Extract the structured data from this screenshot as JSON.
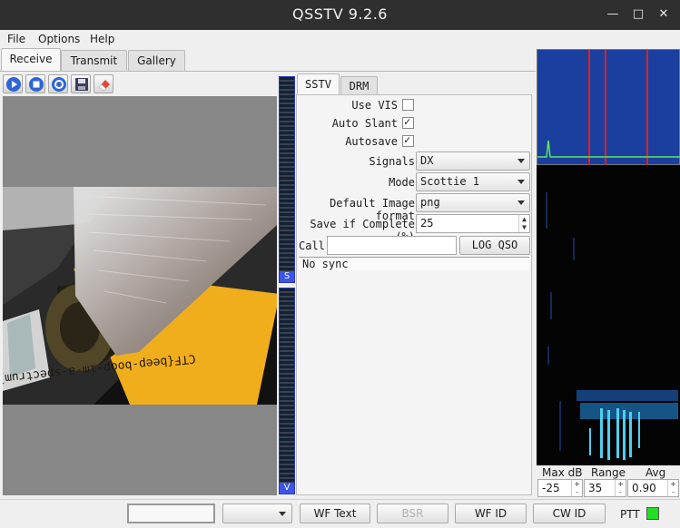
{
  "window": {
    "title": "QSSTV 9.2.6"
  },
  "menu": [
    "File",
    "Options",
    "Help"
  ],
  "main_tabs": [
    "Receive",
    "Transmit",
    "Gallery"
  ],
  "toolbar": {
    "icons": [
      "play-icon",
      "stop-icon",
      "reset-icon",
      "save-icon",
      "eraser-icon"
    ]
  },
  "image": {
    "caption_text": "CTF{beep-boop-im-a-spectrum}"
  },
  "vu": {
    "signal_label": "S",
    "volume_label": "V"
  },
  "sstv": {
    "tabs": [
      "SSTV",
      "DRM"
    ],
    "use_vis": {
      "label": "Use VIS",
      "checked": false
    },
    "auto_slant": {
      "label": "Auto Slant",
      "checked": true
    },
    "autosave": {
      "label": "Autosave",
      "checked": true
    },
    "signals": {
      "label": "Signals",
      "value": "DX"
    },
    "mode": {
      "label": "Mode",
      "value": "Scottie 1"
    },
    "image_format": {
      "label": "Default Image format",
      "value": "png"
    },
    "save_complete": {
      "label": "Save if Complete (%)",
      "value": "25"
    },
    "call": {
      "label": "Call:",
      "value": ""
    },
    "log_qso": "LOG QSO",
    "status": "No sync"
  },
  "spectrum": {
    "max_db_label": "Max dB",
    "range_label": "Range",
    "avg_label": "Avg",
    "max_db": "-25",
    "range": "35",
    "avg": "0.90"
  },
  "bottom": {
    "wf_text": "WF Text",
    "bsr": "BSR",
    "wf_id": "WF ID",
    "cw_id": "CW ID",
    "ptt": "PTT"
  },
  "colors": {
    "ptt_indicator": "#22dd22",
    "vu_accent": "#3b55e8",
    "spectrum_bg": "#1a3f9e",
    "marker": "#e02020"
  }
}
